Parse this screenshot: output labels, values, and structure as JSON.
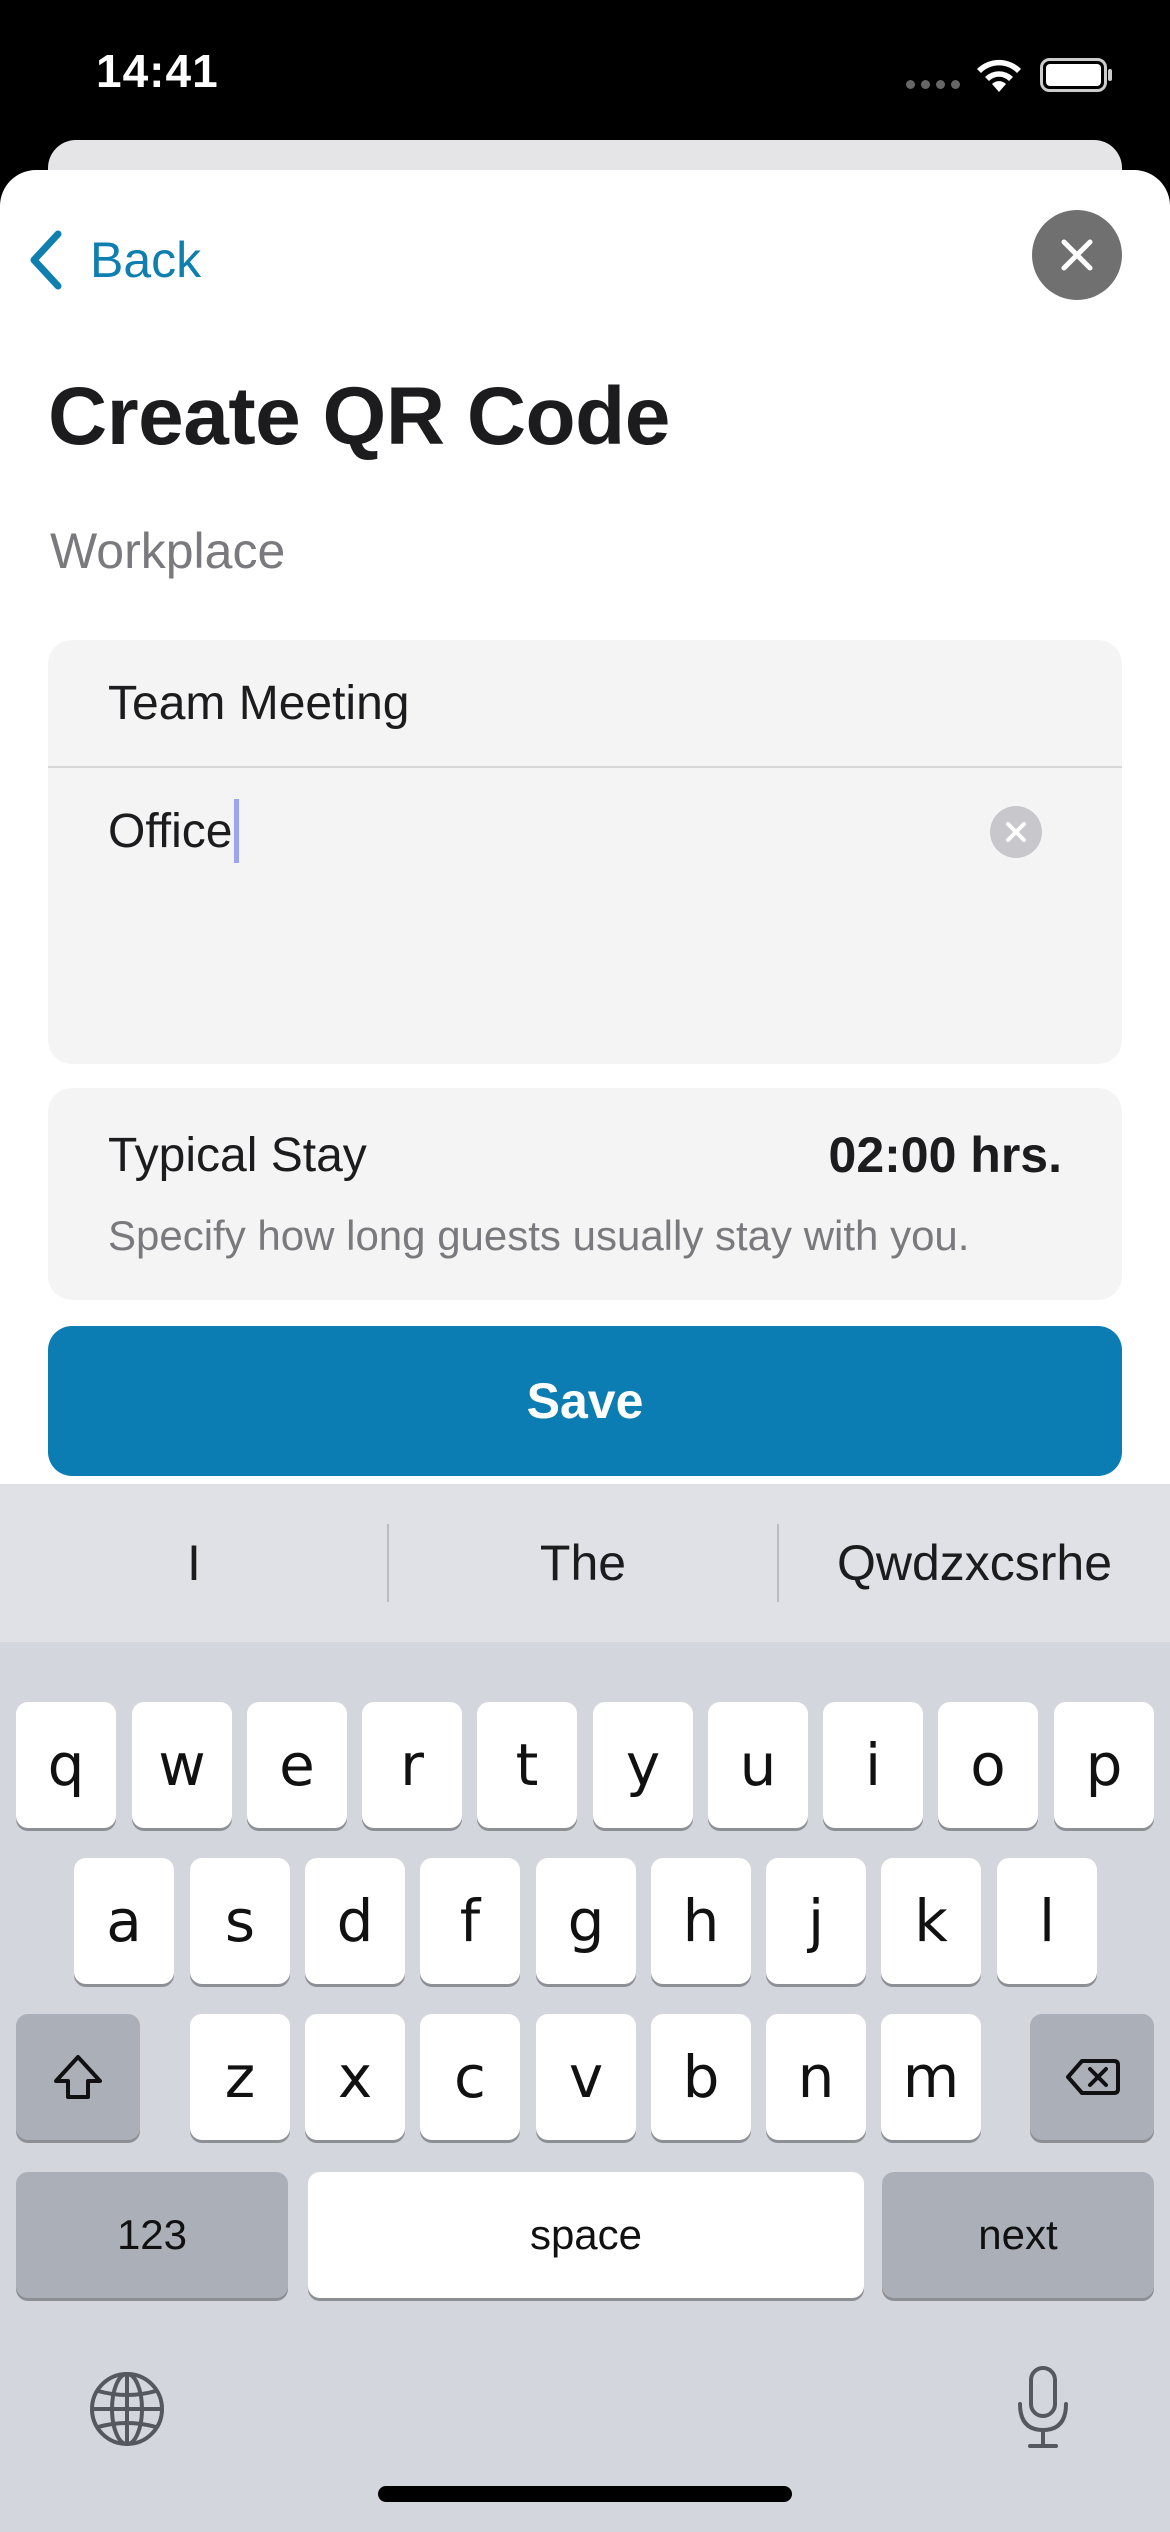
{
  "status_bar": {
    "time": "14:41"
  },
  "header": {
    "back_label": "Back",
    "title": "Create QR Code"
  },
  "form": {
    "section_label": "Workplace",
    "name_value": "Team Meeting",
    "location_value": "Office",
    "typical_stay": {
      "label": "Typical Stay",
      "value": "02:00 hrs.",
      "help": "Specify how long guests usually stay with you."
    }
  },
  "actions": {
    "save_label": "Save"
  },
  "keyboard": {
    "suggestions": [
      "I",
      "The",
      "Qwdzxcsrhe"
    ],
    "row1": [
      "q",
      "w",
      "e",
      "r",
      "t",
      "y",
      "u",
      "i",
      "o",
      "p"
    ],
    "row2": [
      "a",
      "s",
      "d",
      "f",
      "g",
      "h",
      "j",
      "k",
      "l"
    ],
    "row3": [
      "z",
      "x",
      "c",
      "v",
      "b",
      "n",
      "m"
    ],
    "numbers_label": "123",
    "space_label": "space",
    "return_label": "next"
  },
  "colors": {
    "accent": "#0b7db2",
    "link": "#0f7fb0"
  }
}
